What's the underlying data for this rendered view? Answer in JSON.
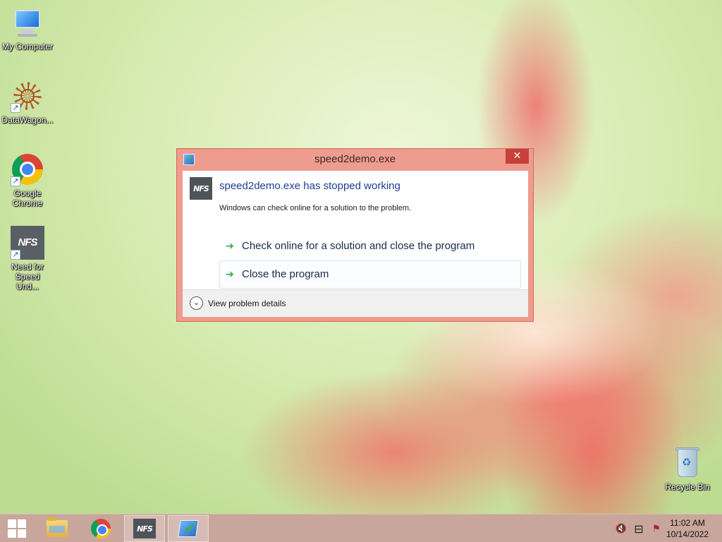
{
  "desktop": {
    "icons": [
      {
        "label": "My Computer",
        "icon": "computer-icon"
      },
      {
        "label": "DataWagon...",
        "icon": "datawagon-icon"
      },
      {
        "label": "Google Chrome",
        "icon": "chrome-icon"
      },
      {
        "label": "Need for Speed Und...",
        "icon": "nfs-icon"
      },
      {
        "label": "Recycle Bin",
        "icon": "recycle-bin-icon"
      }
    ]
  },
  "dialog": {
    "title": "speed2demo.exe",
    "close_glyph": "✕",
    "app_icon_text": "NFS",
    "main_instruction": "speed2demo.exe has stopped working",
    "content": "Windows can check online for a solution to the problem.",
    "commands": [
      {
        "label": "Check online for a solution and close the program"
      },
      {
        "label": "Close the program"
      }
    ],
    "arrow_glyph": "➔",
    "expander_glyph": "⌄",
    "footer_label": "View problem details"
  },
  "taskbar": {
    "nfs_text": "NFS",
    "tray": {
      "volume_glyph": "🔇",
      "network_glyph": "⊟",
      "flag_glyph": "⚑"
    },
    "clock": {
      "time": "11:02 AM",
      "date": "10/14/2022"
    }
  },
  "colors": {
    "dialog_frame": "#ee9c8e",
    "close_button": "#c7413a",
    "main_instruction": "#1e3f8f",
    "taskbar": "#c8a69b",
    "command_arrow": "#2ca640"
  }
}
